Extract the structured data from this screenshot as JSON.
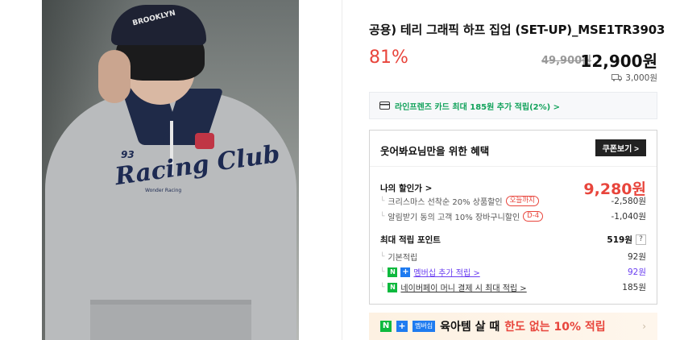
{
  "product": {
    "title": "공용) 테리 그래픽 하프 집업 (SET-UP)_MSE1TR3903",
    "discount_rate": "81%",
    "original_price": "49,900원",
    "sale_price": "12,900원",
    "shipping_fee": "3,000원"
  },
  "photo": {
    "cap_text": "BROOKLYN",
    "logo_number": "93",
    "logo_script": "Racing Club",
    "logo_subtext": "Wonder Racing"
  },
  "card_banner": {
    "text": "라인프렌즈 카드 최대 185원 추가 적립(2%) >"
  },
  "benefit": {
    "heading": "웃어봐요님만을 위한 혜택",
    "coupon_button": "쿠폰보기 >",
    "my_price_label": "나의 할인가 >",
    "my_price_value": "9,280원",
    "discounts": [
      {
        "label": "크리스마스 선착순 20% 상품할인",
        "tag": "오늘까지",
        "value": "-2,580원"
      },
      {
        "label": "알림받기 동의 고객 10% 장바구니할인",
        "tag": "D-4",
        "value": "-1,040원"
      }
    ],
    "points_label": "최대 적립 포인트",
    "points_value": "519원",
    "points_help": "?",
    "points": [
      {
        "label": "기본적립",
        "value": "92원"
      },
      {
        "label": "멤버십 추가 적립 >",
        "value": "92원"
      },
      {
        "label": "네이버페이 머니 결제 시 최대 적립 >",
        "value": "185원"
      }
    ]
  },
  "promo": {
    "membership_badge": "멤버십",
    "text_black": "육아템 살 때",
    "text_red": "한도 없는 10% 적립"
  },
  "colors": {
    "accent_red": "#e8453c",
    "naver_green": "#0eb93e",
    "membership_blue": "#1e7bf0",
    "card_green": "#12a25b"
  }
}
